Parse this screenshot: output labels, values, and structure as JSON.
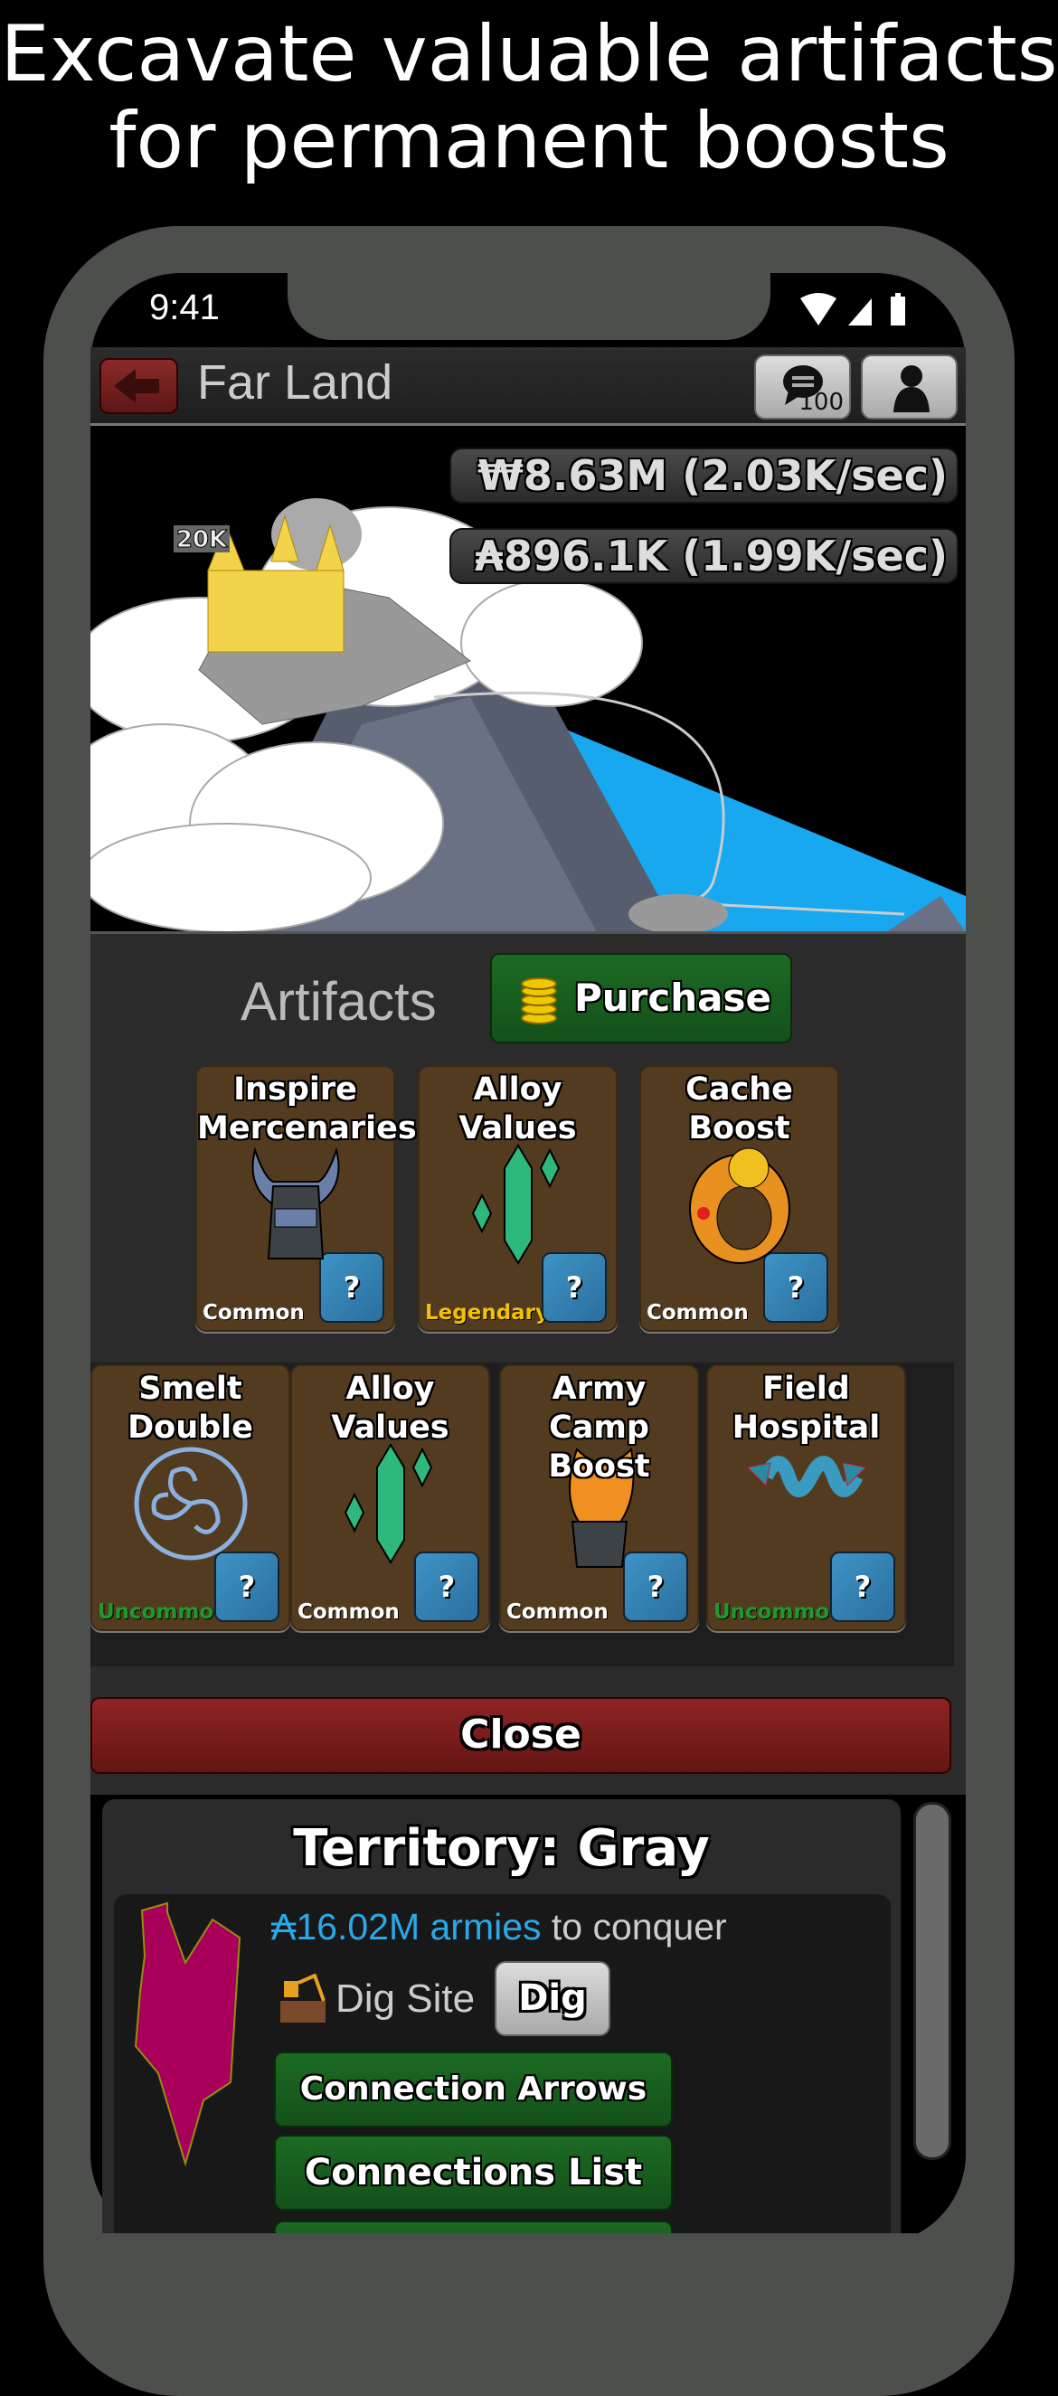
{
  "promo": {
    "line1": "Excavate valuable artifacts",
    "line2": "for permanent boosts"
  },
  "status_bar": {
    "time": "9:41",
    "icons": [
      "wifi-icon",
      "signal-icon",
      "battery-icon"
    ]
  },
  "header": {
    "title": "Far Land",
    "back_icon": "arrow-left-icon",
    "chat_badge": "100",
    "chat_icon": "chat-icon",
    "profile_icon": "person-icon"
  },
  "resources": {
    "gold": "₩8.63M (2.03K/sec)",
    "armies": "₳896.1K (1.99K/sec)"
  },
  "map": {
    "castle_label": "20K"
  },
  "artifacts": {
    "title": "Artifacts",
    "purchase_label": "Purchase",
    "help_label": "?",
    "row1": [
      {
        "name": "Inspire Mercenaries",
        "rarity": "Common",
        "icon": "viking-helmet-icon"
      },
      {
        "name": "Alloy Values",
        "rarity": "Legendary",
        "icon": "crystal-icon"
      },
      {
        "name": "Cache Boost",
        "rarity": "Common",
        "icon": "skull-ring-icon"
      }
    ],
    "row2": [
      {
        "name": "Smelt Double",
        "rarity": "Uncommon",
        "icon": "triskelion-amulet-icon"
      },
      {
        "name": "Alloy Values",
        "rarity": "Common",
        "icon": "crystal-icon"
      },
      {
        "name": "Army Camp Boost",
        "rarity": "Common",
        "icon": "flame-armor-icon"
      },
      {
        "name": "Field Hospital",
        "rarity": "Uncommon",
        "icon": "serpent-icon"
      }
    ],
    "close_label": "Close",
    "rarity_colors": {
      "Common": "#ffffff",
      "Legendary": "#f2c200",
      "Uncommon": "#1f9a2a"
    }
  },
  "territory": {
    "title": "Territory: Gray",
    "armies_amount": "₳16.02M armies",
    "armies_suffix": " to conquer",
    "dig_site_label": "Dig Site",
    "dig_button": "Dig",
    "buttons": [
      "Connection Arrows",
      "Connections List"
    ],
    "shape_color": "#a8005a",
    "accent": "#2aa8e8"
  }
}
